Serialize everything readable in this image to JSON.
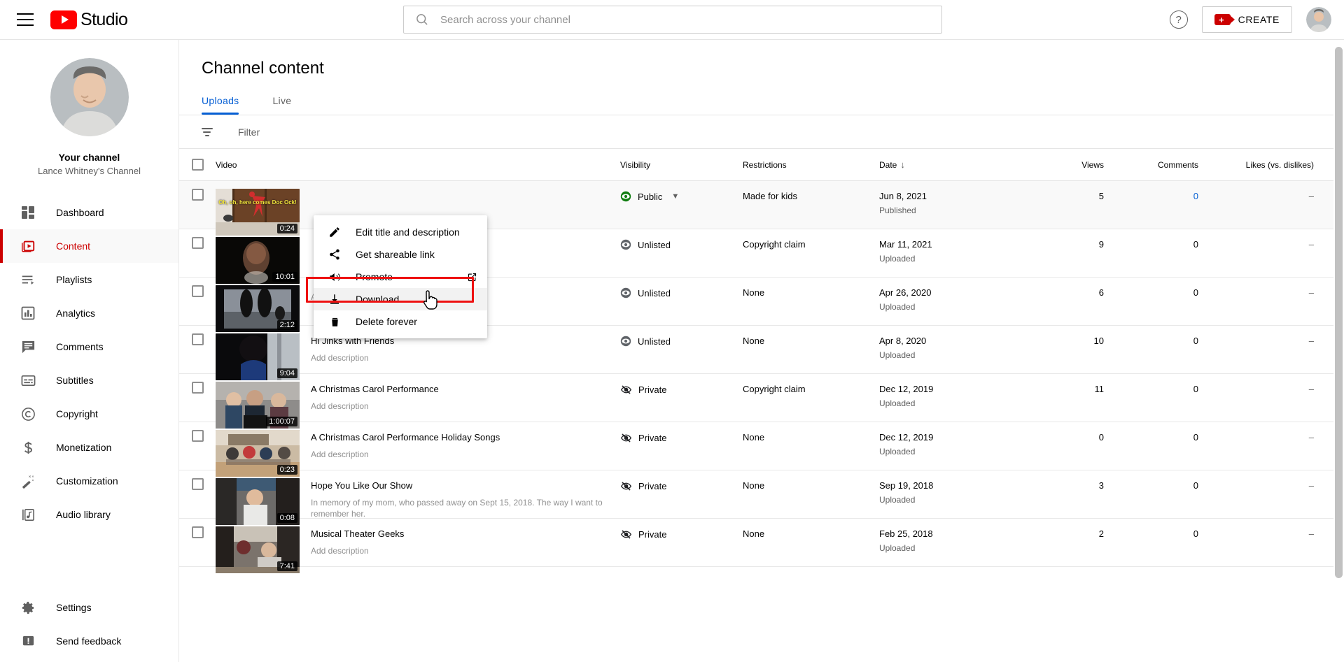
{
  "topbar": {
    "menu_icon": "hamburger-menu-icon",
    "logo_text": "Studio",
    "search": {
      "value": "",
      "placeholder": "Search across your channel",
      "icon": "search-icon"
    },
    "help_label": "?",
    "create_label": "CREATE",
    "avatar": "user-avatar"
  },
  "sidebar": {
    "channel_title": "Your channel",
    "channel_name": "Lance Whitney's Channel",
    "items": [
      {
        "label": "Dashboard",
        "icon": "dashboard-icon",
        "active": false
      },
      {
        "label": "Content",
        "icon": "content-icon",
        "active": true
      },
      {
        "label": "Playlists",
        "icon": "playlists-icon",
        "active": false
      },
      {
        "label": "Analytics",
        "icon": "analytics-icon",
        "active": false
      },
      {
        "label": "Comments",
        "icon": "comments-icon",
        "active": false
      },
      {
        "label": "Subtitles",
        "icon": "subtitles-icon",
        "active": false
      },
      {
        "label": "Copyright",
        "icon": "copyright-icon",
        "active": false
      },
      {
        "label": "Monetization",
        "icon": "dollar-icon",
        "active": false
      },
      {
        "label": "Customization",
        "icon": "magic-wand-icon",
        "active": false
      },
      {
        "label": "Audio library",
        "icon": "audio-library-icon",
        "active": false
      }
    ],
    "bottom_items": [
      {
        "label": "Settings",
        "icon": "gear-icon"
      },
      {
        "label": "Send feedback",
        "icon": "feedback-icon"
      }
    ]
  },
  "main": {
    "page_title": "Channel content",
    "tabs": [
      {
        "label": "Uploads",
        "active": true
      },
      {
        "label": "Live",
        "active": false
      }
    ],
    "filter": {
      "label": "Filter",
      "icon": "filter-icon"
    },
    "columns": {
      "video": "Video",
      "visibility": "Visibility",
      "restrictions": "Restrictions",
      "date": "Date",
      "date_sort": "↓",
      "views": "Views",
      "comments": "Comments",
      "likes": "Likes (vs. dislikes)"
    },
    "rows": [
      {
        "title": "",
        "description": "",
        "duration": "0:24",
        "thumb_caption": "Oh, oh, here comes Doc Ock!",
        "visibility": "Public",
        "visibility_icon": "eye-public-icon",
        "has_caret": true,
        "restrictions": "Made for kids",
        "date": "Jun 8, 2021",
        "date_status": "Published",
        "views": "5",
        "comments": "0",
        "comments_link": true,
        "likes": "–"
      },
      {
        "title": "",
        "description": "",
        "duration": "10:01",
        "thumb_caption": "",
        "visibility": "Unlisted",
        "visibility_icon": "eye-unlisted-icon",
        "has_caret": false,
        "restrictions": "Copyright claim",
        "date": "Mar 11, 2021",
        "date_status": "Uploaded",
        "views": "9",
        "comments": "0",
        "comments_link": false,
        "likes": "–"
      },
      {
        "title": "",
        "description": "Add description",
        "duration": "2:12",
        "thumb_caption": "",
        "visibility": "Unlisted",
        "visibility_icon": "eye-unlisted-icon",
        "has_caret": false,
        "restrictions": "None",
        "date": "Apr 26, 2020",
        "date_status": "Uploaded",
        "views": "6",
        "comments": "0",
        "comments_link": false,
        "likes": "–"
      },
      {
        "title": "Hi Jinks with Friends",
        "description": "Add description",
        "duration": "9:04",
        "thumb_caption": "",
        "visibility": "Unlisted",
        "visibility_icon": "eye-unlisted-icon",
        "has_caret": false,
        "restrictions": "None",
        "date": "Apr 8, 2020",
        "date_status": "Uploaded",
        "views": "10",
        "comments": "0",
        "comments_link": false,
        "likes": "–"
      },
      {
        "title": "A Christmas Carol Performance",
        "description": "Add description",
        "duration": "1:00:07",
        "thumb_caption": "",
        "visibility": "Private",
        "visibility_icon": "eye-private-icon",
        "has_caret": false,
        "restrictions": "Copyright claim",
        "date": "Dec 12, 2019",
        "date_status": "Uploaded",
        "views": "11",
        "comments": "0",
        "comments_link": false,
        "likes": "–"
      },
      {
        "title": "A Christmas Carol Performance Holiday Songs",
        "description": "Add description",
        "duration": "0:23",
        "thumb_caption": "",
        "visibility": "Private",
        "visibility_icon": "eye-private-icon",
        "has_caret": false,
        "restrictions": "None",
        "date": "Dec 12, 2019",
        "date_status": "Uploaded",
        "views": "0",
        "comments": "0",
        "comments_link": false,
        "likes": "–"
      },
      {
        "title": "Hope You Like Our Show",
        "description": "In memory of my mom, who passed away on Sept 15, 2018. The way I want to remember her.",
        "duration": "0:08",
        "thumb_caption": "",
        "visibility": "Private",
        "visibility_icon": "eye-private-icon",
        "has_caret": false,
        "restrictions": "None",
        "date": "Sep 19, 2018",
        "date_status": "Uploaded",
        "views": "3",
        "comments": "0",
        "comments_link": false,
        "likes": "–"
      },
      {
        "title": "Musical Theater Geeks",
        "description": "Add description",
        "duration": "7:41",
        "thumb_caption": "",
        "visibility": "Private",
        "visibility_icon": "eye-private-icon",
        "has_caret": false,
        "restrictions": "None",
        "date": "Feb 25, 2018",
        "date_status": "Uploaded",
        "views": "2",
        "comments": "0",
        "comments_link": false,
        "likes": "–"
      }
    ]
  },
  "context_menu": {
    "items": [
      {
        "label": "Edit title and description",
        "icon": "pencil-icon",
        "external": false,
        "highlighted": false
      },
      {
        "label": "Get shareable link",
        "icon": "share-icon",
        "external": false,
        "highlighted": false
      },
      {
        "label": "Promote",
        "icon": "megaphone-icon",
        "external": true,
        "highlighted": false
      },
      {
        "label": "Download",
        "icon": "download-icon",
        "external": false,
        "highlighted": true
      },
      {
        "label": "Delete forever",
        "icon": "trash-icon",
        "external": false,
        "highlighted": false
      }
    ]
  },
  "annotation": {
    "highlight_color": "#ee1111",
    "target": "Download"
  }
}
